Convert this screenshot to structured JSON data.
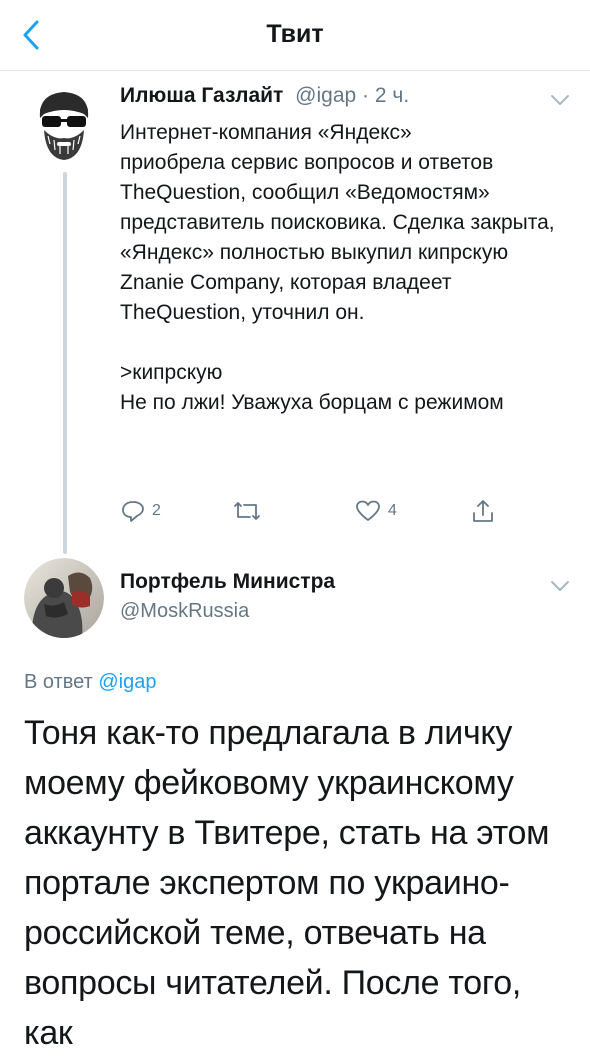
{
  "header": {
    "title": "Твит",
    "back_icon": "chevron-left-icon",
    "accent": "#1da1f2"
  },
  "tweet1": {
    "author_name": "Илюша Газлайт",
    "handle": "@igap",
    "separator": "·",
    "time": "2 ч.",
    "text": "Интернет-компания «Яндекс»\nприобрела сервис вопросов и ответов TheQuestion, сообщил «Ведомостям» представитель поисковика. Сделка закрыта, «Яндекс» полностью выкупил кипрскую Znanie Company, которая владеет TheQuestion, уточнил он.\n\n>кипрскую\nНе по лжи! Уважуха борцам с режимом",
    "actions": {
      "reply_count": "2",
      "retweet_count": "",
      "like_count": "4"
    }
  },
  "tweet2": {
    "author_name": "Портфель Министра",
    "handle": "@MoskRussia",
    "reply_prefix": "В ответ",
    "reply_to": "@igap",
    "text": "Тоня как-то предлагала в личку моему фейковому украинскому аккаунту в Твитере, стать на этом портале экспертом по украино-российской теме, отвечать на вопросы читателей. После того, как"
  }
}
